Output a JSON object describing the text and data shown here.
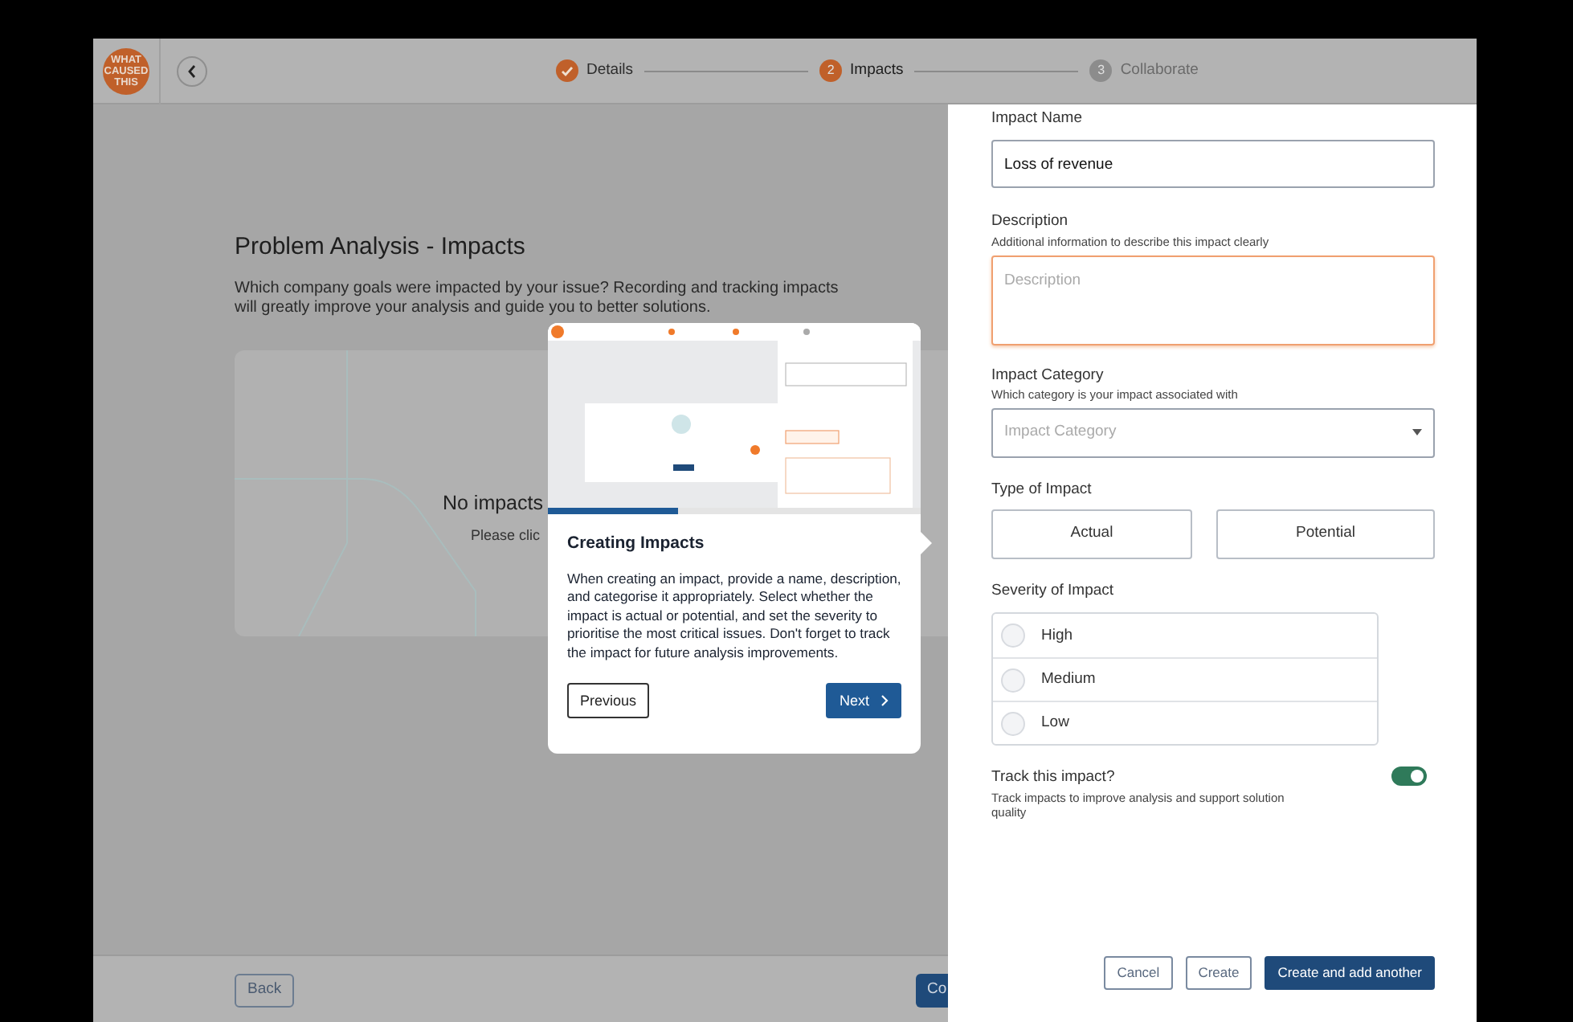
{
  "logo": {
    "lines": [
      "WHAT",
      "CAUSED",
      "THIS"
    ]
  },
  "stepper": [
    {
      "label": "Details",
      "completed": true,
      "current": false
    },
    {
      "number": "2",
      "label": "Impacts",
      "completed": false,
      "current": true
    },
    {
      "number": "3",
      "label": "Collaborate",
      "completed": false,
      "current": false
    }
  ],
  "page": {
    "title": "Problem Analysis - Impacts",
    "description": "Which company goals were impacted by your issue? Recording and tracking impacts will greatly improve your analysis and guide you to better solutions.",
    "empty_state": {
      "heading": "No impacts",
      "hint": "Please clic"
    }
  },
  "footer": {
    "back": "Back",
    "continue": "Co"
  },
  "tour": {
    "progress": {
      "level": 0.35
    },
    "title": "Creating Impacts",
    "body": "When creating an impact, provide a name, description, and categorise it appropriately. Select whether the impact is actual or potential, and set the severity to prioritise the most critical issues. Don't forget to track the impact for future analysis improvements.",
    "previous": "Previous",
    "next": "Next"
  },
  "drawer": {
    "name": {
      "label": "Impact Name",
      "value": "Loss of revenue"
    },
    "description": {
      "label": "Description",
      "hint": "Additional information to describe this impact clearly",
      "placeholder": "Description",
      "focused": true
    },
    "category": {
      "label": "Impact Category",
      "hint": "Which category is your impact associated with",
      "placeholder": "Impact Category"
    },
    "type": {
      "label": "Type of Impact",
      "options": [
        {
          "label": "Actual",
          "selected": false
        },
        {
          "label": "Potential",
          "selected": false
        }
      ]
    },
    "severity": {
      "label": "Severity of Impact",
      "options": [
        {
          "label": "High",
          "selected": false
        },
        {
          "label": "Medium",
          "selected": false
        },
        {
          "label": "Low",
          "selected": false
        }
      ]
    },
    "track": {
      "label": "Track this impact?",
      "hint": "Track impacts to improve analysis and support solution quality",
      "on": true
    },
    "buttons": [
      {
        "label": "Cancel",
        "kind": "secondary"
      },
      {
        "label": "Create",
        "kind": "secondary"
      },
      {
        "label": "Create and add another",
        "kind": "primary"
      }
    ]
  }
}
